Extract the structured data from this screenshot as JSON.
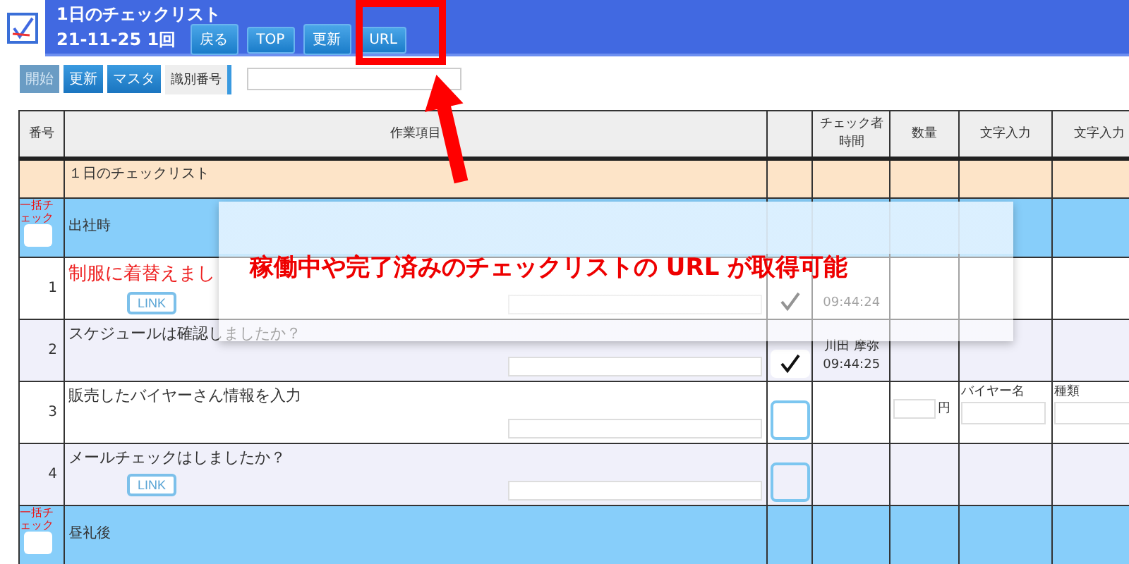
{
  "header": {
    "title": "1日のチェックリスト",
    "subtitle": "21-11-25 1回",
    "buttons": [
      "戻る",
      "TOP",
      "更新",
      "URL"
    ]
  },
  "toolbar": {
    "buttons": [
      {
        "label": "開始",
        "disabled": true
      },
      {
        "label": "更新",
        "disabled": false
      },
      {
        "label": "マスタ",
        "disabled": false
      }
    ],
    "id_label": "識別番号"
  },
  "table": {
    "columns": [
      "番号",
      "作業項目",
      "",
      "チェック者時間",
      "数量",
      "文字入力",
      "文字入力"
    ],
    "rows": [
      {
        "kind": "section",
        "title": "１日のチェックリスト"
      },
      {
        "kind": "group",
        "title": "出社時",
        "bulk_label": "一括チェック",
        "bulk_checked": false
      },
      {
        "kind": "item",
        "number": "1",
        "text": "制服に着替えまし",
        "highlighted": true,
        "link": "LINK",
        "checked": true,
        "checker": "",
        "time": "09:44:24"
      },
      {
        "kind": "item",
        "number": "2",
        "text": "スケジュールは確認しましたか？",
        "highlighted": false,
        "checked": true,
        "checker": "川田 摩弥",
        "time": "09:44:25"
      },
      {
        "kind": "item",
        "number": "3",
        "text": "販売したバイヤーさん情報を入力",
        "highlighted": false,
        "checked": false,
        "unit": "円",
        "extras": [
          "バイヤー名",
          "種類"
        ]
      },
      {
        "kind": "item",
        "number": "4",
        "text": "メールチェックはしましたか？",
        "highlighted": false,
        "link": "LINK",
        "checked": false
      },
      {
        "kind": "group",
        "title": "昼礼後",
        "bulk_label": "一括チェック",
        "bulk_checked": false
      }
    ]
  },
  "callout": {
    "text": "稼働中や完了済みのチェックリストの URL が取得可能"
  }
}
